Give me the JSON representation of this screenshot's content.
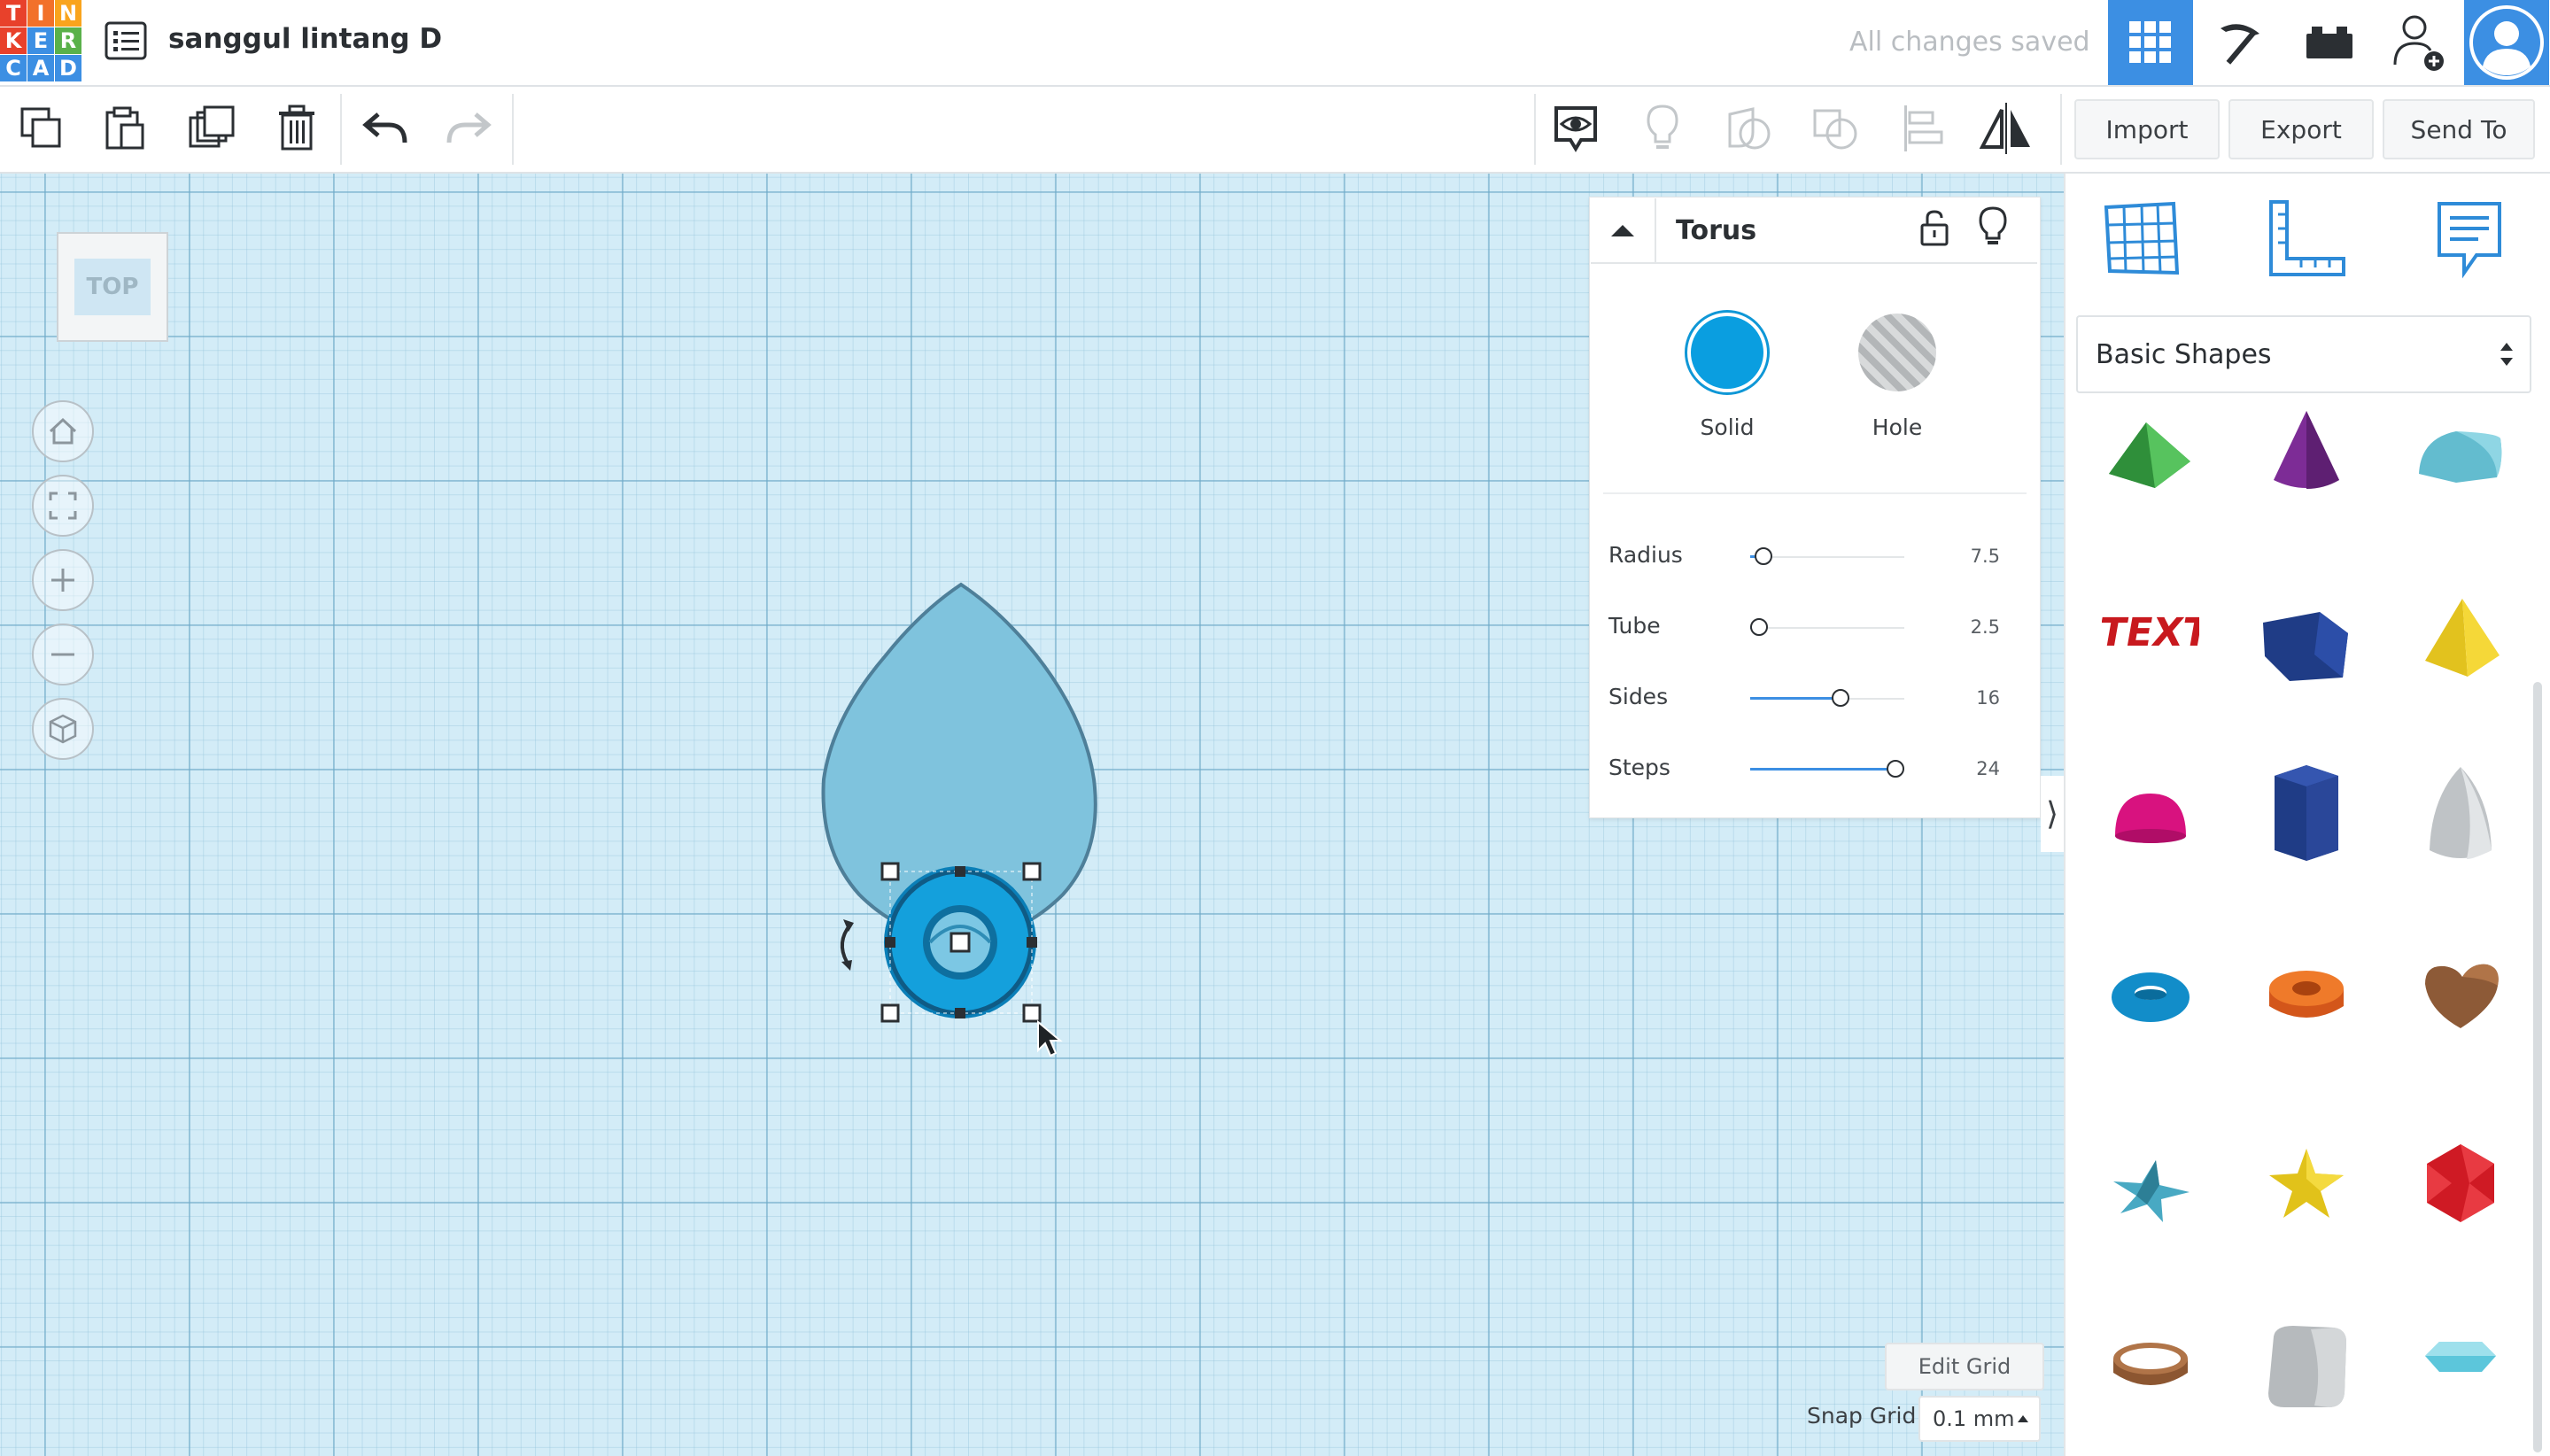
{
  "header": {
    "logo_letters": [
      "T",
      "I",
      "N",
      "K",
      "E",
      "R",
      "C",
      "A",
      "D"
    ],
    "logo_colors": [
      "#e8412b",
      "#f2712a",
      "#f9a41d",
      "#e8412b",
      "#3c8fe3",
      "#5ab14a",
      "#3c8fe3",
      "#3c8fe3",
      "#3c8fe3"
    ],
    "project_title": "sanggul lintang D",
    "save_status": "All changes saved",
    "icons": [
      "list-icon",
      "grid-3d-icon",
      "pickaxe-icon",
      "bricks-icon",
      "add-user-icon",
      "user-avatar-icon"
    ]
  },
  "toolbar": {
    "icons": [
      "copy-icon",
      "paste-icon",
      "duplicate-icon",
      "delete-icon",
      "undo-icon",
      "redo-icon",
      "visibility-icon",
      "light-icon",
      "group-icon",
      "ungroup-icon",
      "align-icon",
      "mirror-icon"
    ],
    "import_label": "Import",
    "export_label": "Export",
    "send_to_label": "Send To"
  },
  "view_cube": {
    "face_label": "TOP"
  },
  "nav_controls": [
    "home-icon",
    "fit-view-icon",
    "zoom-in-icon",
    "zoom-out-icon",
    "perspective-icon"
  ],
  "inspector": {
    "shape_name": "Torus",
    "solid_label": "Solid",
    "hole_label": "Hole",
    "solid_color": "#0a9ee0",
    "params": [
      {
        "label": "Radius",
        "value": "7.5",
        "fraction": 0.03
      },
      {
        "label": "Tube",
        "value": "2.5",
        "fraction": 0.0
      },
      {
        "label": "Sides",
        "value": "16",
        "fraction": 0.6
      },
      {
        "label": "Steps",
        "value": "24",
        "fraction": 1.0
      }
    ]
  },
  "shapes_panel": {
    "tabs": [
      "workplane-icon",
      "ruler-icon",
      "notes-icon"
    ],
    "category": "Basic Shapes",
    "shapes": [
      "roof",
      "cone",
      "half-cylinder",
      "text",
      "box",
      "pyramid",
      "half-sphere",
      "polygon",
      "paraboloid",
      "torus",
      "tube",
      "heart",
      "star",
      "star-gold",
      "icosahedron",
      "ring",
      "round-cube",
      "diamond"
    ]
  },
  "grid": {
    "edit_grid_label": "Edit Grid",
    "snap_grid_label": "Snap Grid",
    "snap_grid_value": "0.1 mm"
  },
  "colors": {
    "accent": "#3c8fe3",
    "workplane": "#d3ecf7",
    "selected_shape": "#0a9ee0",
    "teardrop_shape": "#7fc3dd"
  }
}
